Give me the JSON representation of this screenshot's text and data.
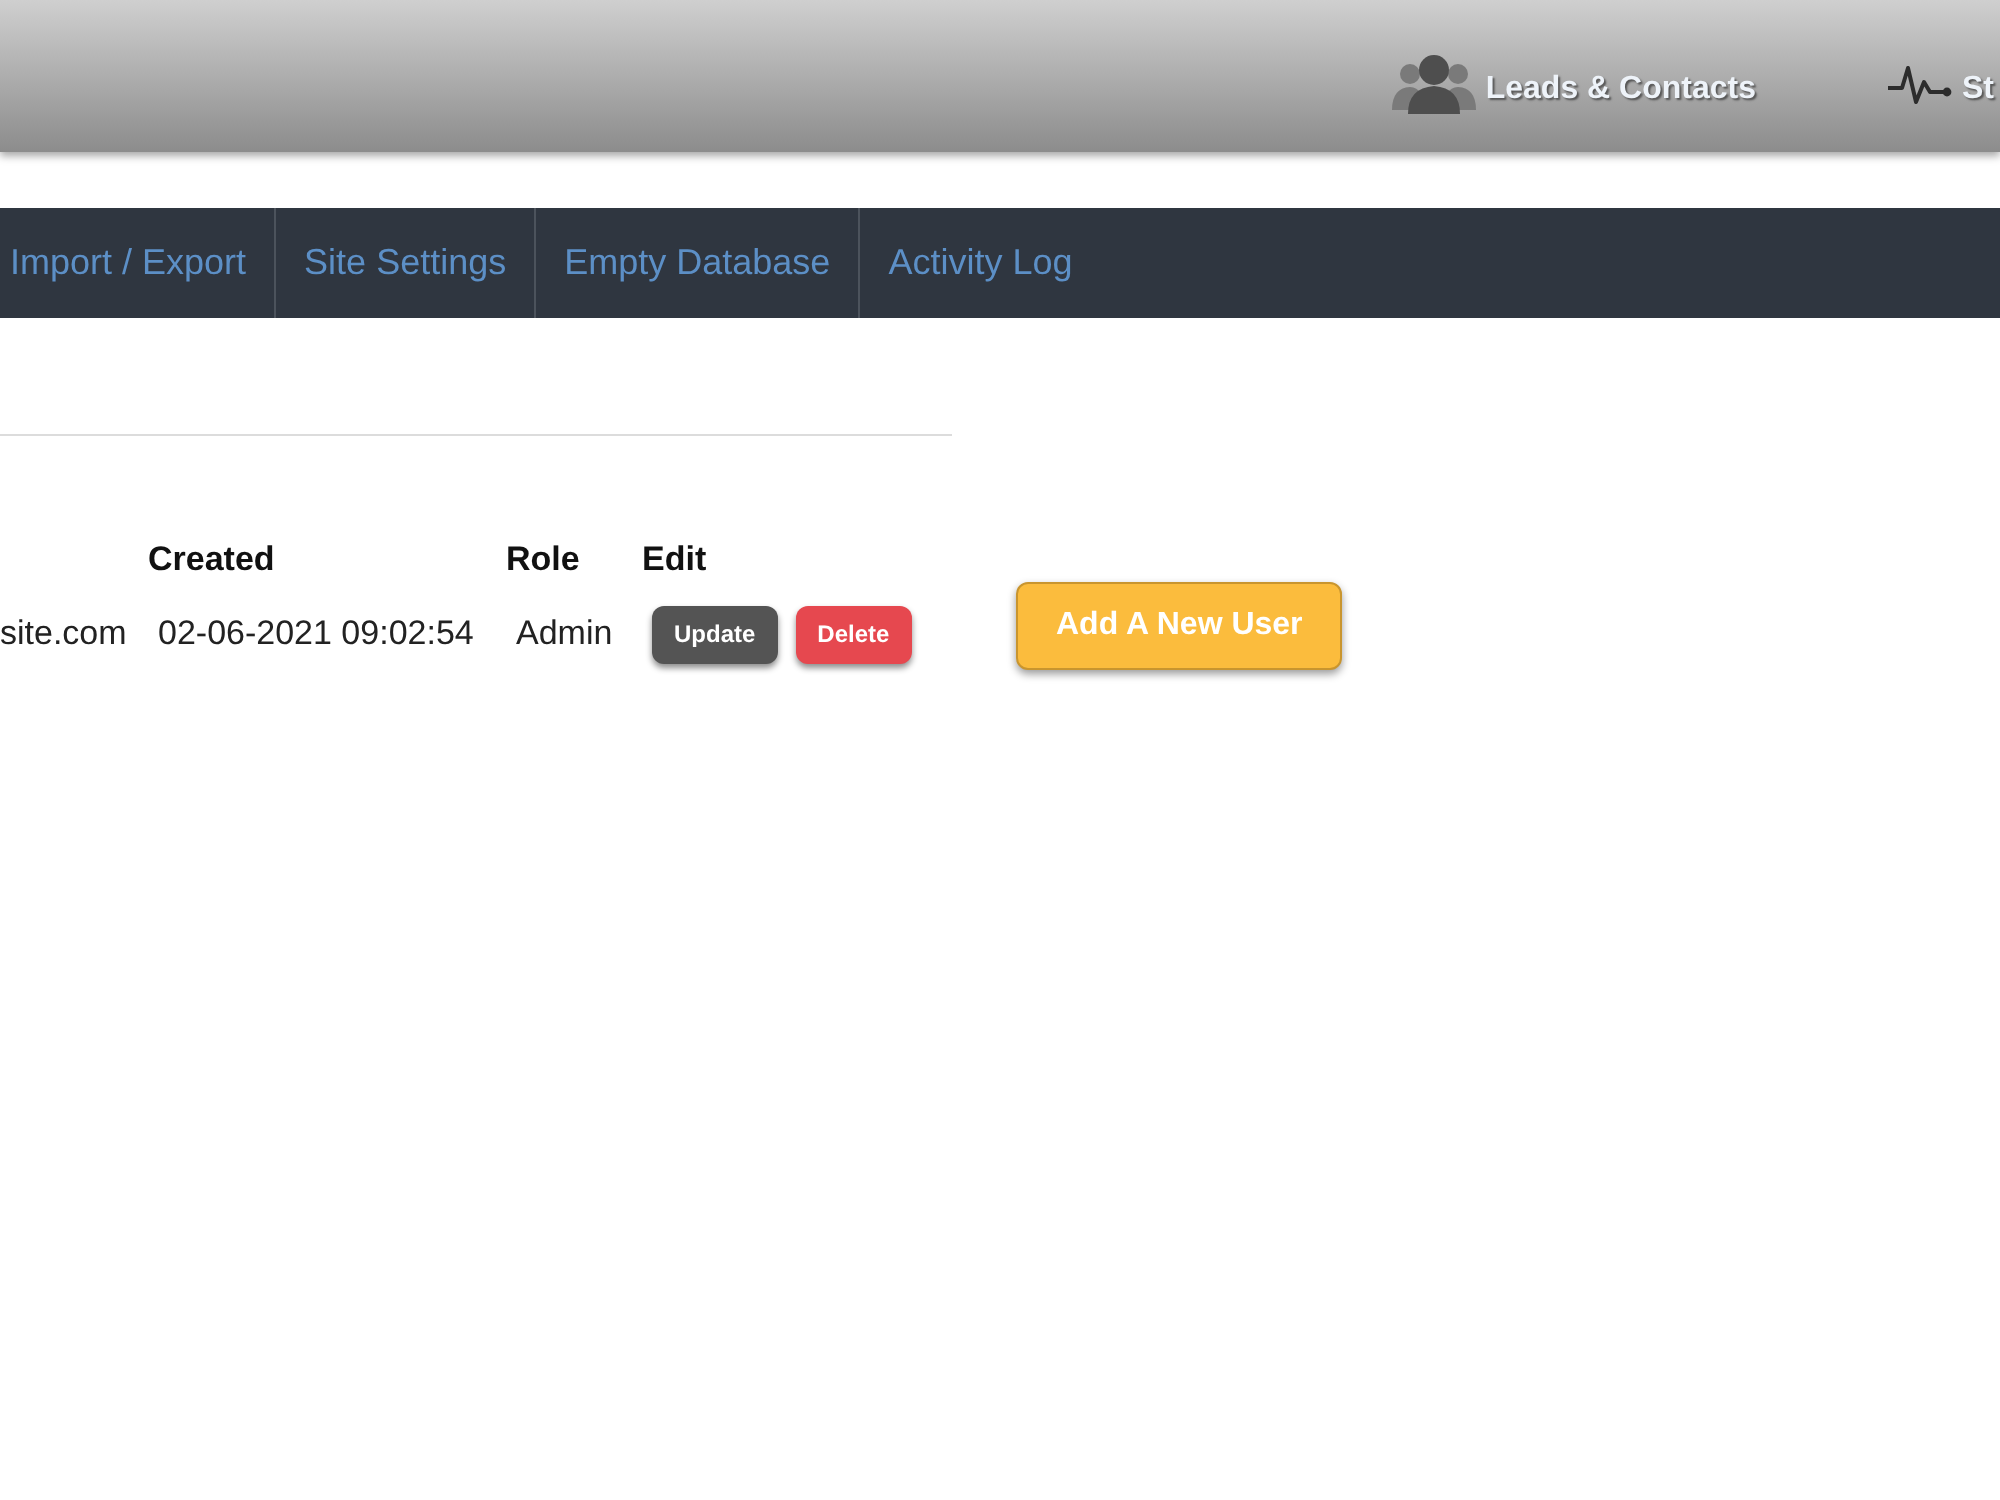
{
  "header": {
    "links": [
      {
        "label": "Leads & Contacts"
      },
      {
        "label": "St"
      }
    ]
  },
  "nav": {
    "items": [
      {
        "label": "Import / Export"
      },
      {
        "label": "Site Settings"
      },
      {
        "label": "Empty Database"
      },
      {
        "label": "Activity Log"
      }
    ]
  },
  "table": {
    "columns": [
      "",
      "Created",
      "Role",
      "Edit"
    ],
    "rows": [
      {
        "cells": [
          "site.com",
          "02-06-2021 09:02:54",
          "Admin"
        ],
        "actions": [
          {
            "label": "Update",
            "kind": "update"
          },
          {
            "label": "Delete",
            "kind": "delete"
          }
        ]
      }
    ]
  },
  "add_button": {
    "label": "Add A New User"
  }
}
